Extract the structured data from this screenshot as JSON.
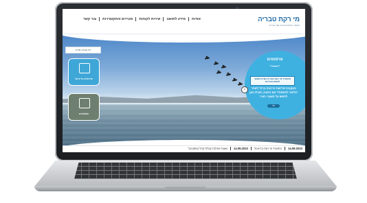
{
  "site": {
    "logo_title": "מי רקת טבריה",
    "logo_tagline": "תאגיד המים והביוב של טבריה"
  },
  "nav": {
    "items": [
      {
        "label": "אודות"
      },
      {
        "label": "מידע לתושב"
      },
      {
        "label": "שירות לקוחות"
      },
      {
        "label": "מכרזים והתקשרויות"
      },
      {
        "label": "צור קשר"
      }
    ]
  },
  "breadcrumb": "דף הבית / מידע",
  "tiles": [
    {
      "label": "שירותים בדיגיטל",
      "icon": "monitor-icon",
      "color": "#3ea7d7"
    },
    {
      "label": "תשלומים",
      "icon": "credit-card-icon",
      "color": "#6e7f6f"
    }
  ],
  "promo": {
    "title": "פרסומים",
    "box_text": "התאגיד מי רקת טבריה מציע לאנשי לבשת מכרזים",
    "body": "בעקבות פלישת הרכבת ברזל לאחר הלחצי להתמודד עם ההצה, תוכלו כאן לחפש על תשובי העיר",
    "more_label": "עוד"
  },
  "ticker": [
    {
      "date": "14.09.2023",
      "text": "התאגיד מי רקת בדיגיטל"
    },
    {
      "date": "14.09.2023",
      "text": "שעות פעילות קבלת קהל בפסטיבל"
    }
  ],
  "colors": {
    "brand_blue": "#1d67a3",
    "promo": "#3fb1e1",
    "tile_teal": "#3ea7d7",
    "tile_grey": "#6e7f6f"
  }
}
